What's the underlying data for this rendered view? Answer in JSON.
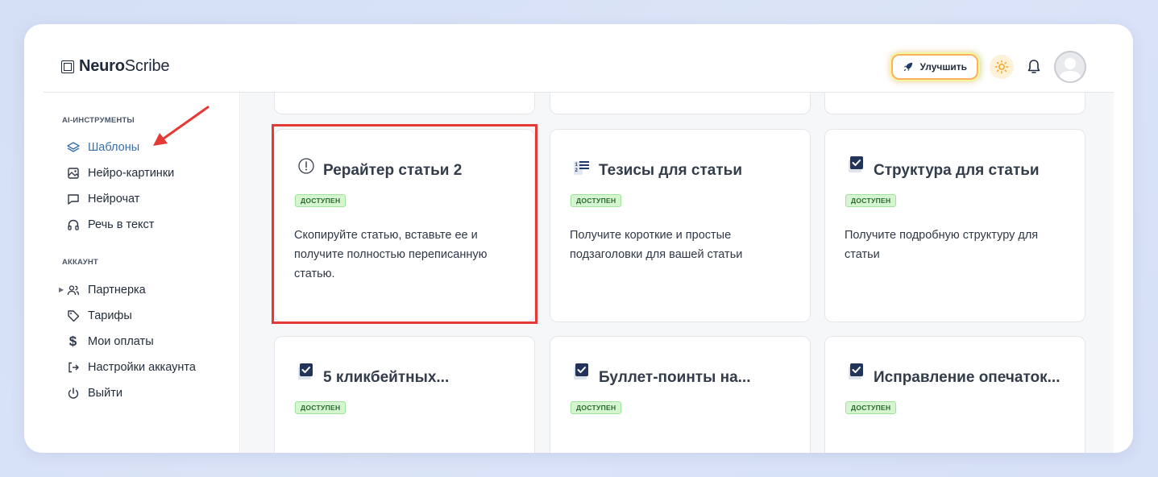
{
  "app": {
    "logo_bold": "Neuro",
    "logo_rest": "Scribe",
    "upgrade_label": "Улучшить"
  },
  "sidebar": {
    "section_tools": "AI-ИНСТРУМЕНТЫ",
    "section_account": "АККАУНТ",
    "tools": [
      {
        "label": "Шаблоны",
        "icon": "layers-icon"
      },
      {
        "label": "Нейро-картинки",
        "icon": "image-icon"
      },
      {
        "label": "Нейрочат",
        "icon": "chat-icon"
      },
      {
        "label": "Речь в текст",
        "icon": "headphones-icon"
      }
    ],
    "account": [
      {
        "label": "Партнерка",
        "icon": "users-icon"
      },
      {
        "label": "Тарифы",
        "icon": "tag-icon"
      },
      {
        "label": "Мои оплаты",
        "icon": "dollar-icon"
      },
      {
        "label": "Настройки аккаунта",
        "icon": "login-icon"
      },
      {
        "label": "Выйти",
        "icon": "power-icon"
      }
    ]
  },
  "cards": [
    {
      "title": "Рерайтер статьи 2",
      "badge": "ДОСТУПЕН",
      "desc": "Скопируйте статью, вставьте ее и получите полностью переписанную статью.",
      "icon": "alert-circle-icon"
    },
    {
      "title": "Тезисы для статьи",
      "badge": "ДОСТУПЕН",
      "desc": "Получите короткие и простые подзаголовки для вашей статьи",
      "icon": "numbered-list-icon"
    },
    {
      "title": "Структура для статьи",
      "badge": "ДОСТУПЕН",
      "desc": "Получите подробную структуру для статьи",
      "icon": "checkbox-icon"
    },
    {
      "title": "5 кликбейтных...",
      "badge": "ДОСТУПЕН",
      "desc": "",
      "icon": "checkbox-icon"
    },
    {
      "title": "Буллет-поинты на...",
      "badge": "ДОСТУПЕН",
      "desc": "",
      "icon": "checkbox-icon"
    },
    {
      "title": "Исправление опечаток...",
      "badge": "ДОСТУПЕН",
      "desc": "",
      "icon": "checkbox-icon"
    }
  ],
  "colors": {
    "accent": "#3b6fa8",
    "badge_bg": "#d4f5cf",
    "highlight": "#e53935"
  }
}
